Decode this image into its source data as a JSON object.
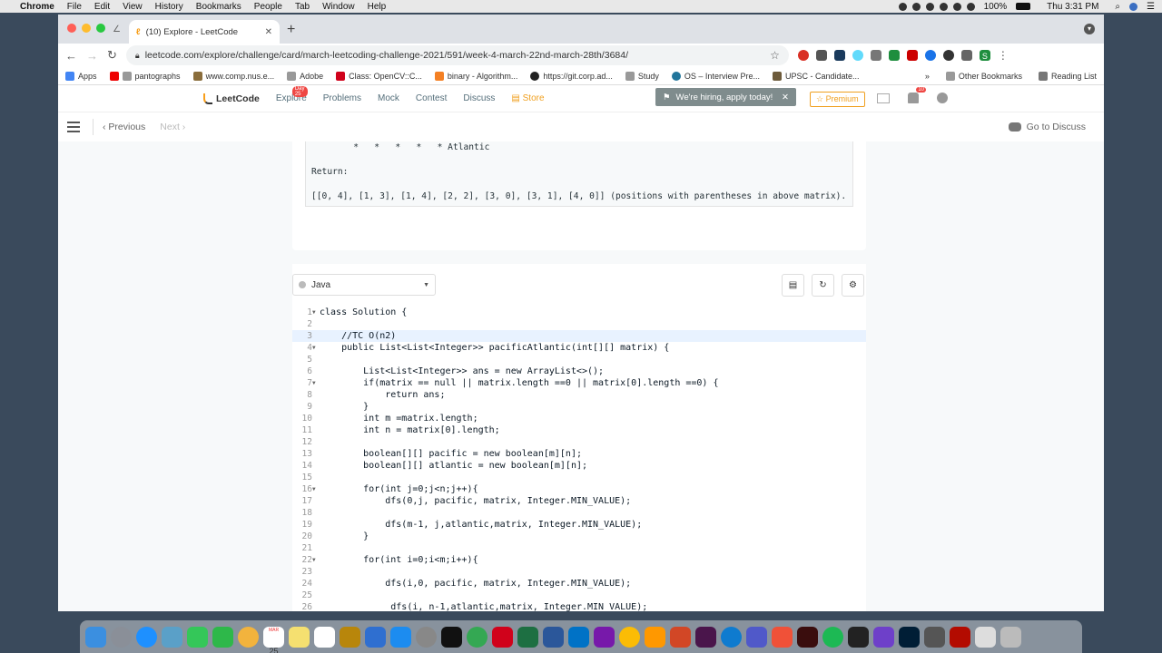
{
  "menubar": {
    "app": "Chrome",
    "items": [
      "File",
      "Edit",
      "View",
      "History",
      "Bookmarks",
      "People",
      "Tab",
      "Window",
      "Help"
    ],
    "battery": "100%",
    "clock": "Thu 3:31 PM"
  },
  "browser": {
    "tab_title": "(10) Explore - LeetCode",
    "url": "leetcode.com/explore/challenge/card/march-leetcoding-challenge-2021/591/week-4-march-22nd-march-28th/3684/",
    "profile_initial": "S",
    "bookmarks": [
      "Apps",
      "pantographs",
      "www.comp.nus.e...",
      "Adobe",
      "Class: OpenCV::C...",
      "binary - Algorithm...",
      "https://git.corp.ad...",
      "Study",
      "OS – Interview Pre...",
      "UPSC - Candidate..."
    ],
    "bookmarks_more": "»",
    "other_bookmarks": "Other Bookmarks",
    "reading_list": "Reading List"
  },
  "leetcode_nav": {
    "logo": "LeetCode",
    "explore": "Explore",
    "day_badge": "Day 25",
    "problems": "Problems",
    "mock": "Mock",
    "contest": "Contest",
    "discuss": "Discuss",
    "store": "Store",
    "hiring": "We're hiring, apply today!",
    "premium": "Premium",
    "notification_count": "10"
  },
  "subbar": {
    "previous": "Previous",
    "next": "Next",
    "go_to_discuss": "Go to Discuss"
  },
  "example": {
    "line1": "        *   *   *   *   * Atlantic",
    "line2": "Return:",
    "line3": "[[0, 4], [1, 3], [1, 4], [2, 2], [3, 0], [3, 1], [4, 0]] (positions with parentheses in above matrix)."
  },
  "editor": {
    "language": "Java",
    "lines": [
      {
        "n": "1",
        "fold": true,
        "code": "class Solution {"
      },
      {
        "n": "2",
        "fold": false,
        "code": ""
      },
      {
        "n": "3",
        "fold": false,
        "code": "    //TC O(n2)",
        "active": true
      },
      {
        "n": "4",
        "fold": true,
        "code": "    public List<List<Integer>> pacificAtlantic(int[][] matrix) {"
      },
      {
        "n": "5",
        "fold": false,
        "code": ""
      },
      {
        "n": "6",
        "fold": false,
        "code": "        List<List<Integer>> ans = new ArrayList<>();"
      },
      {
        "n": "7",
        "fold": true,
        "code": "        if(matrix == null || matrix.length ==0 || matrix[0].length ==0) {"
      },
      {
        "n": "8",
        "fold": false,
        "code": "            return ans;"
      },
      {
        "n": "9",
        "fold": false,
        "code": "        }"
      },
      {
        "n": "10",
        "fold": false,
        "code": "        int m =matrix.length;"
      },
      {
        "n": "11",
        "fold": false,
        "code": "        int n = matrix[0].length;"
      },
      {
        "n": "12",
        "fold": false,
        "code": ""
      },
      {
        "n": "13",
        "fold": false,
        "code": "        boolean[][] pacific = new boolean[m][n];"
      },
      {
        "n": "14",
        "fold": false,
        "code": "        boolean[][] atlantic = new boolean[m][n];"
      },
      {
        "n": "15",
        "fold": false,
        "code": ""
      },
      {
        "n": "16",
        "fold": true,
        "code": "        for(int j=0;j<n;j++){"
      },
      {
        "n": "17",
        "fold": false,
        "code": "            dfs(0,j, pacific, matrix, Integer.MIN_VALUE);"
      },
      {
        "n": "18",
        "fold": false,
        "code": ""
      },
      {
        "n": "19",
        "fold": false,
        "code": "            dfs(m-1, j,atlantic,matrix, Integer.MIN_VALUE);"
      },
      {
        "n": "20",
        "fold": false,
        "code": "        }"
      },
      {
        "n": "21",
        "fold": false,
        "code": ""
      },
      {
        "n": "22",
        "fold": true,
        "code": "        for(int i=0;i<m;i++){"
      },
      {
        "n": "23",
        "fold": false,
        "code": ""
      },
      {
        "n": "24",
        "fold": false,
        "code": "            dfs(i,0, pacific, matrix, Integer.MIN_VALUE);"
      },
      {
        "n": "25",
        "fold": false,
        "code": ""
      },
      {
        "n": "26",
        "fold": false,
        "code": "             dfs(i, n-1,atlantic,matrix, Integer.MIN_VALUE);"
      }
    ]
  },
  "dock": {
    "calendar_month": "MAR",
    "calendar_day": "25"
  }
}
